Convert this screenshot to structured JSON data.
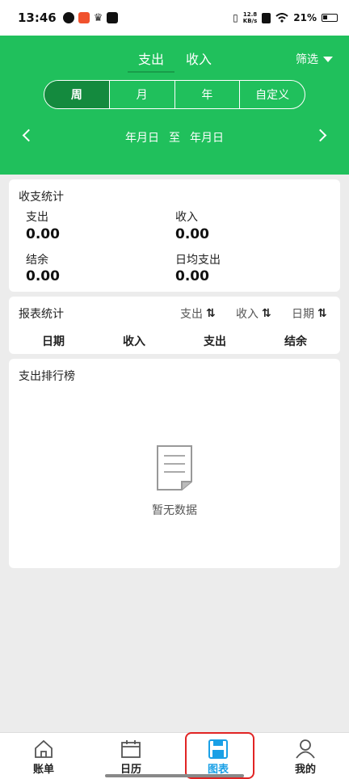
{
  "status": {
    "time": "13:46",
    "speed_top": "12.8",
    "speed_bottom": "KB/s",
    "battery": "21%"
  },
  "header": {
    "tabs": [
      "支出",
      "收入"
    ],
    "filter_label": "筛选",
    "periods": [
      "周",
      "月",
      "年",
      "自定义"
    ],
    "date_start": "年月日",
    "date_sep": "至",
    "date_end": "年月日"
  },
  "summary": {
    "title": "收支统计",
    "expense_label": "支出",
    "expense_value": "0.00",
    "income_label": "收入",
    "income_value": "0.00",
    "balance_label": "结余",
    "balance_value": "0.00",
    "daily_label": "日均支出",
    "daily_value": "0.00"
  },
  "report": {
    "title": "报表统计",
    "sort": [
      "支出",
      "收入",
      "日期"
    ],
    "sort_icon": "⇅",
    "columns": [
      "日期",
      "收入",
      "支出",
      "结余"
    ]
  },
  "ranking": {
    "title": "支出排行榜",
    "empty_text": "暂无数据"
  },
  "nav": {
    "items": [
      "账单",
      "日历",
      "图表",
      "我的"
    ],
    "active_color": "#1aa0e6"
  },
  "colors": {
    "brand_green": "#20c05c",
    "active_segment": "#148a3e",
    "highlight": "#e12424"
  }
}
